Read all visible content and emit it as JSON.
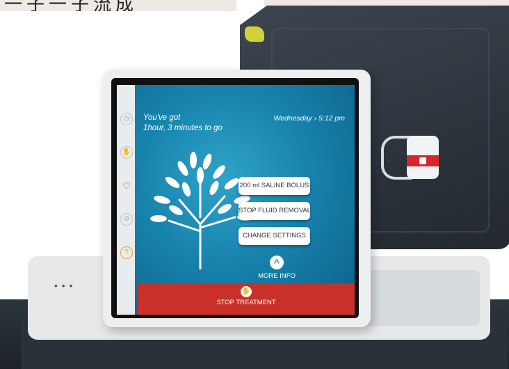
{
  "banner": {
    "text": "一子一子流成"
  },
  "screen": {
    "remaining": "You've got\n1hour, 3 minutes to go",
    "datetime": "Wednesday › 5:12 pm",
    "actions": [
      "200 ml SALINE BOLUS",
      "STOP FLUID REMOVAL",
      "CHANGE SETTINGS"
    ],
    "more_info": "MORE INFO",
    "stop": "STOP TREATMENT"
  },
  "side_rail": {
    "icons": [
      "clock-icon",
      "hand-wave-icon",
      "heart-icon",
      "lock-icon",
      "help-icon"
    ]
  },
  "colors": {
    "screen_blue": "#1783ad",
    "stop_red": "#c9302a",
    "more_green": "#1ea36b"
  }
}
